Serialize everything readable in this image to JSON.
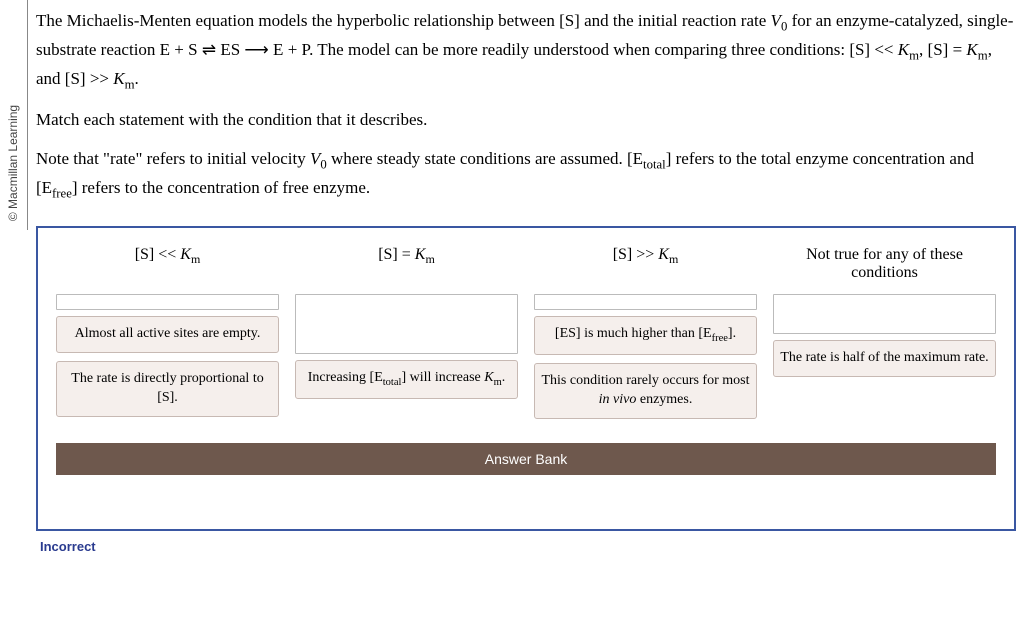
{
  "branding": {
    "label": "© Macmillan Learning"
  },
  "intro": {
    "p1_a": "The Michaelis-Menten equation models the hyperbolic relationship between [S] and the initial reaction rate ",
    "p1_v": "V",
    "p1_v_sub": "0",
    "p1_b": " for an enzyme-catalyzed, single-substrate reaction E + S ⇌ ES ⟶ E + P. The model can be more readily understood when comparing three conditions: [S] << ",
    "km": "K",
    "km_sub": "m",
    "p1_c": ", [S] = ",
    "p1_d": ", and [S] >> ",
    "p1_e": ".",
    "p2": "Match each statement with the condition that it describes.",
    "p3_a": "Note that \"rate\" refers to initial velocity ",
    "p3_b": " where steady state conditions are assumed. [E",
    "p3_total": "total",
    "p3_c": "] refers to the total enzyme concentration and [E",
    "p3_free": "free",
    "p3_d": "] refers to the concentration of free enzyme."
  },
  "columns": {
    "c1": {
      "head_a": "[S] << ",
      "head_k": "K",
      "head_km": "m"
    },
    "c2": {
      "head_a": "[S] = ",
      "head_k": "K",
      "head_km": "m"
    },
    "c3": {
      "head_a": "[S] >> ",
      "head_k": "K",
      "head_km": "m"
    },
    "c4": {
      "head": "Not true for any of these conditions"
    }
  },
  "cards": {
    "a1": "Almost all active sites are empty.",
    "a2": "The rate is directly proportional to [S].",
    "b1_a": "Increasing [E",
    "b1_sub": "total",
    "b1_b": "] will increase ",
    "b1_k": "K",
    "b1_km": "m",
    "b1_c": ".",
    "c1_a": "[ES] is much higher than [E",
    "c1_sub": "free",
    "c1_b": "].",
    "c2_a": "This condition rarely occurs for most ",
    "c2_it": "in vivo",
    "c2_b": " enzymes.",
    "d1": "The rate is half of the maximum rate."
  },
  "bank": {
    "title": "Answer Bank"
  },
  "status": {
    "text": "Incorrect"
  }
}
